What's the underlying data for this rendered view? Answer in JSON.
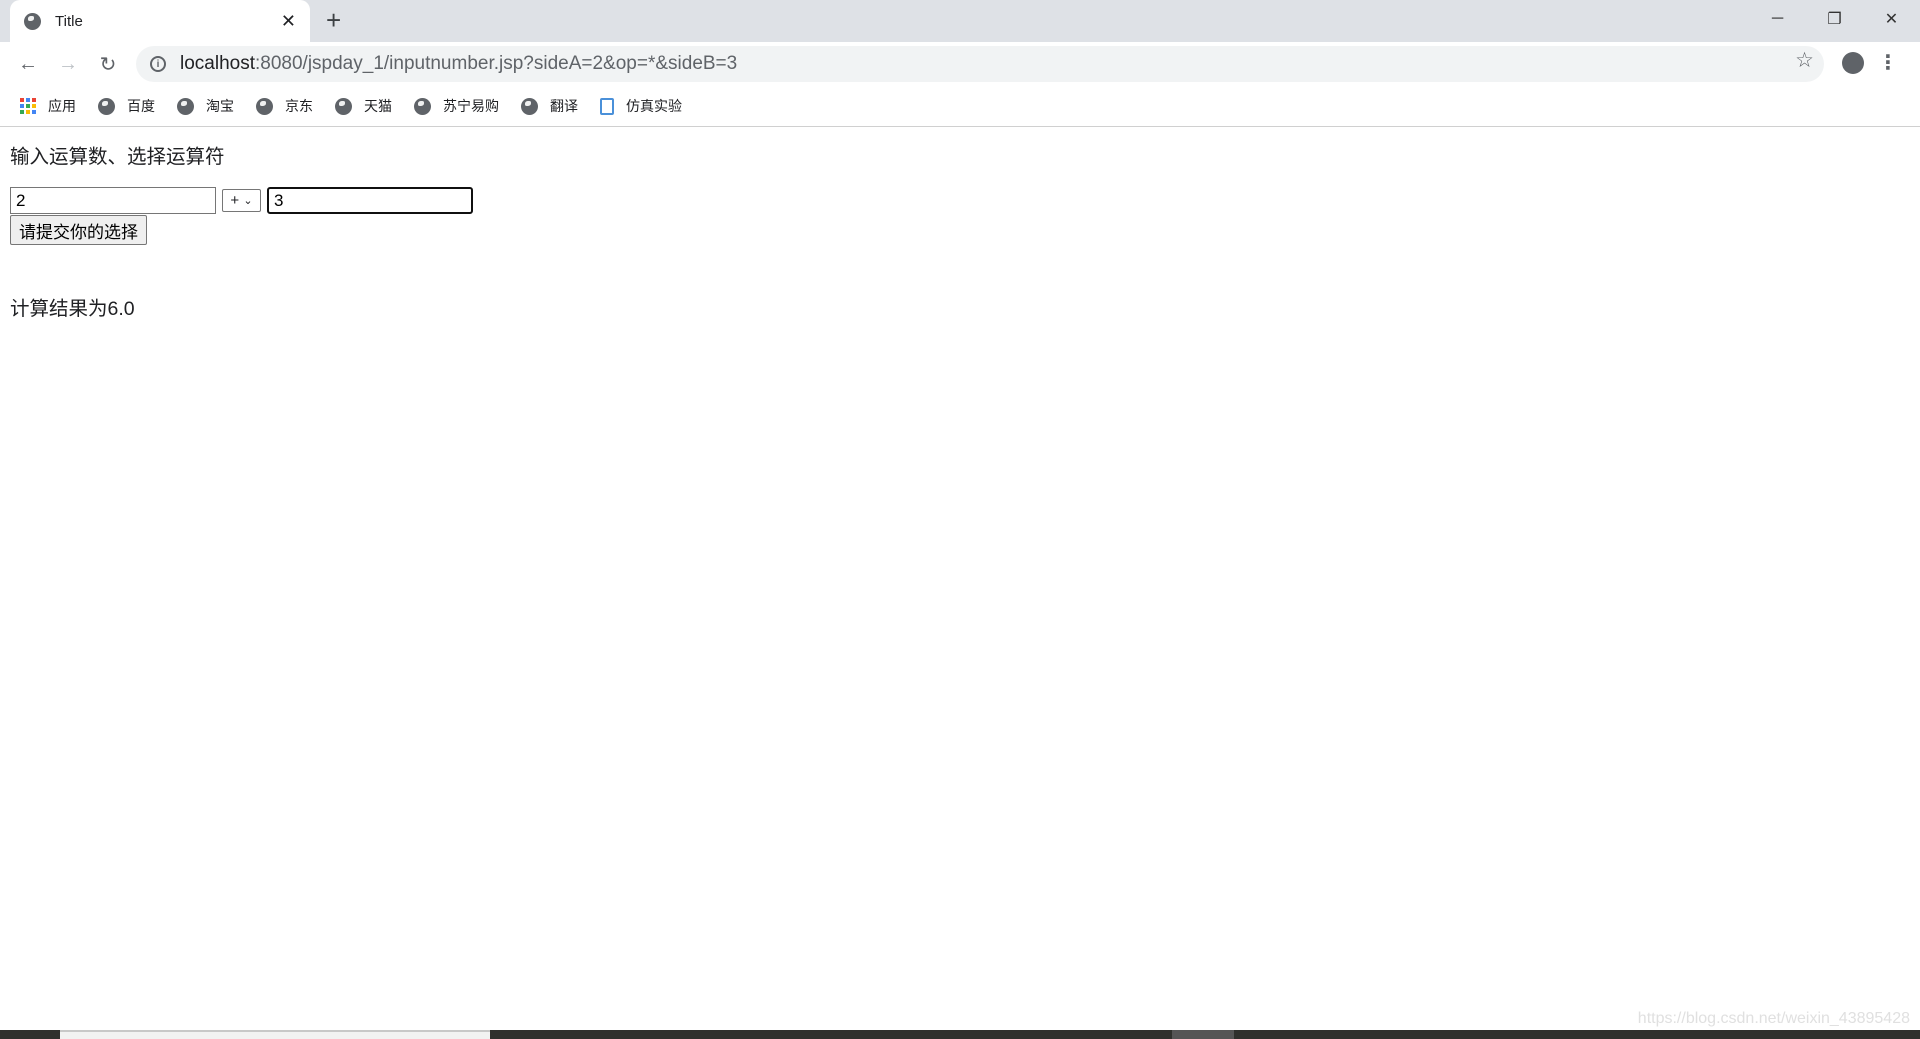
{
  "browser": {
    "tab": {
      "title": "Title",
      "icon": "globe-icon"
    },
    "new_tab": "+",
    "window_controls": {
      "minimize": "─",
      "restore": "❐",
      "close": "✕"
    },
    "url": {
      "host": "localhost",
      "rest": ":8080/jspday_1/inputnumber.jsp?sideA=2&op=*&sideB=3"
    },
    "bookmarks": [
      {
        "label": "应用",
        "icon": "apps-icon"
      },
      {
        "label": "百度",
        "icon": "globe-icon"
      },
      {
        "label": "淘宝",
        "icon": "globe-icon"
      },
      {
        "label": "京东",
        "icon": "globe-icon"
      },
      {
        "label": "天猫",
        "icon": "globe-icon"
      },
      {
        "label": "苏宁易购",
        "icon": "globe-icon"
      },
      {
        "label": "翻译",
        "icon": "globe-icon"
      },
      {
        "label": "仿真实验",
        "icon": "document-search-icon"
      }
    ]
  },
  "page": {
    "heading": "输入运算数、选择运算符",
    "sideA": "2",
    "operator": "+",
    "sideB": "3",
    "submit_label": "请提交你的选择",
    "result": "计算结果为6.0"
  },
  "watermark": "https://blog.csdn.net/weixin_43895428"
}
